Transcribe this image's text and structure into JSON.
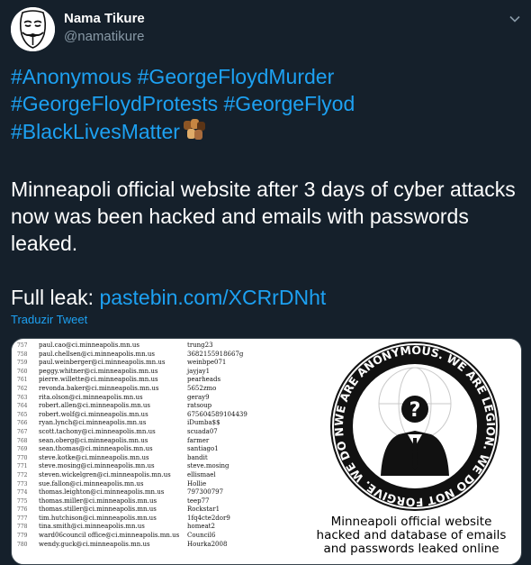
{
  "user": {
    "display_name": "Nama Tikure",
    "handle": "@namatikure"
  },
  "menu": {
    "icon": "chevron-down-icon"
  },
  "tweet": {
    "hashtags_line1": [
      "#Anonymous",
      "#GeorgeFloydMurder"
    ],
    "hashtags_line2": [
      "#GeorgeFloydProtests",
      "#GeorgeFlyod"
    ],
    "hashtags_line3": [
      "#BlackLivesMatter"
    ],
    "emoji": "raised-fists-icon",
    "body": "Minneapoli official website after 3 days of cyber attacks now was been hacked and emails with passwords leaked.",
    "leak_label": "Full leak:",
    "leak_link": "pastebin.com/XCRrDNht",
    "translate": "Traduzir Tweet"
  },
  "media": {
    "leak_rows": [
      {
        "num": "757",
        "email": "paul.cao@ci.minneapolis.mn.us",
        "pass": "trung23"
      },
      {
        "num": "758",
        "email": "paul.chellsen@ci.minneapolis.mn.us",
        "pass": "3682155918667g"
      },
      {
        "num": "759",
        "email": "paul.weinberger@ci.minneapolis.mn.us",
        "pass": "weinbpe071"
      },
      {
        "num": "760",
        "email": "peggy.whitner@ci.minneapolis.mn.us",
        "pass": "jayjay1"
      },
      {
        "num": "761",
        "email": "pierre.willette@ci.minneapolis.mn.us",
        "pass": "pearheads"
      },
      {
        "num": "762",
        "email": "revonda.baker@ci.minneapolis.mn.us",
        "pass": "5652zmo"
      },
      {
        "num": "763",
        "email": "rita.olson@ci.minneapolis.mn.us",
        "pass": "geray9"
      },
      {
        "num": "764",
        "email": "robert.allen@ci.minneapolis.mn.us",
        "pass": "ratsoup"
      },
      {
        "num": "765",
        "email": "robert.wolf@ci.minneapolis.mn.us",
        "pass": "675604589104439"
      },
      {
        "num": "766",
        "email": "ryan.lynch@ci.minneapolis.mn.us",
        "pass": "iDumba$$"
      },
      {
        "num": "767",
        "email": "scott.tachony@ci.minneapolis.mn.us",
        "pass": "scuada07"
      },
      {
        "num": "768",
        "email": "sean.oberg@ci.minneapolis.mn.us",
        "pass": "farmer"
      },
      {
        "num": "769",
        "email": "sean.thomas@ci.minneapolis.mn.us",
        "pass": "santiago1"
      },
      {
        "num": "770",
        "email": "steve.kotke@ci.minneapolis.mn.us",
        "pass": "bandit"
      },
      {
        "num": "771",
        "email": "steve.mosing@ci.minneapolis.mn.us",
        "pass": "steve.mosing"
      },
      {
        "num": "772",
        "email": "steven.wickelgren@ci.minneapolis.mn.us",
        "pass": "ellismael"
      },
      {
        "num": "773",
        "email": "sue.fallon@ci.minneapolis.mn.us",
        "pass": "Hollie"
      },
      {
        "num": "774",
        "email": "thomas.leighton@ci.minneapolis.mn.us",
        "pass": "797300797"
      },
      {
        "num": "775",
        "email": "thomas.miller@ci.minneapolis.mn.us",
        "pass": "teep77"
      },
      {
        "num": "776",
        "email": "thomas.stiller@ci.minneapolis.mn.us",
        "pass": "Rockstar1"
      },
      {
        "num": "777",
        "email": "tim.hutchison@ci.minneapolis.mn.us",
        "pass": "1fq4cte2dor9"
      },
      {
        "num": "778",
        "email": "tina.smith@ci.minneapolis.mn.us",
        "pass": "homeat2"
      },
      {
        "num": "779",
        "email": "ward06council office@ci.minneapolis.mn.us",
        "pass": "Council6"
      },
      {
        "num": "780",
        "email": "wendy.guck@ci.minneapolis.mn.us",
        "pass": "Hourka2008"
      }
    ],
    "seal_text": "WE ARE ANONYMOUS. WE ARE LEGION. WE DO NOT FORGIVE. WE DO NOT FORGET. EXPECT US. KNOWLEDGE IS FREE.",
    "seal_icon": "anonymous-suit-logo",
    "caption": [
      "Minneapoli official website",
      "hacked and database of emails",
      "and passwords leaked online"
    ]
  },
  "colors": {
    "background": "#15202b",
    "link": "#1da1f2",
    "secondary_text": "#8899a6"
  }
}
